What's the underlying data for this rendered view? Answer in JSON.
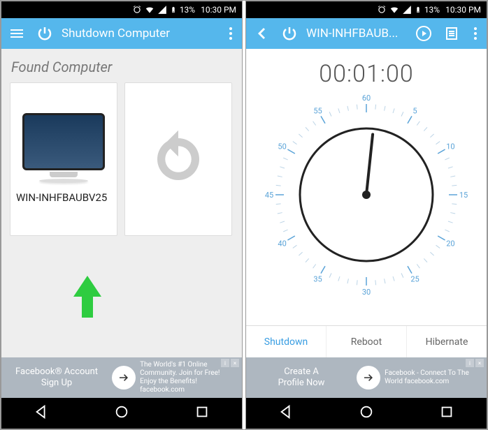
{
  "status": {
    "battery_pct": "13%",
    "time": "10:30 PM"
  },
  "left": {
    "title": "Shutdown Computer",
    "section": "Found Computer",
    "computer_name": "WIN-INHFBAUBV25",
    "ad": {
      "left_line1": "Facebook® Account",
      "left_line2": "Sign Up",
      "right": "The World's #1 Online Community. Join for Free! Enjoy the Benefits! facebook.com"
    }
  },
  "right": {
    "title": "WIN-INHFBAUB...",
    "timer": "00:01:00",
    "dial": {
      "ticks": [
        "5",
        "10",
        "15",
        "20",
        "25",
        "30",
        "35",
        "40",
        "45",
        "50",
        "55",
        "60"
      ]
    },
    "tabs": {
      "shutdown": "Shutdown",
      "reboot": "Reboot",
      "hibernate": "Hibernate",
      "active": "shutdown"
    },
    "ad": {
      "left_line1": "Create A",
      "left_line2": "Profile Now",
      "right": "Facebook - Connect To The World facebook.com"
    }
  }
}
